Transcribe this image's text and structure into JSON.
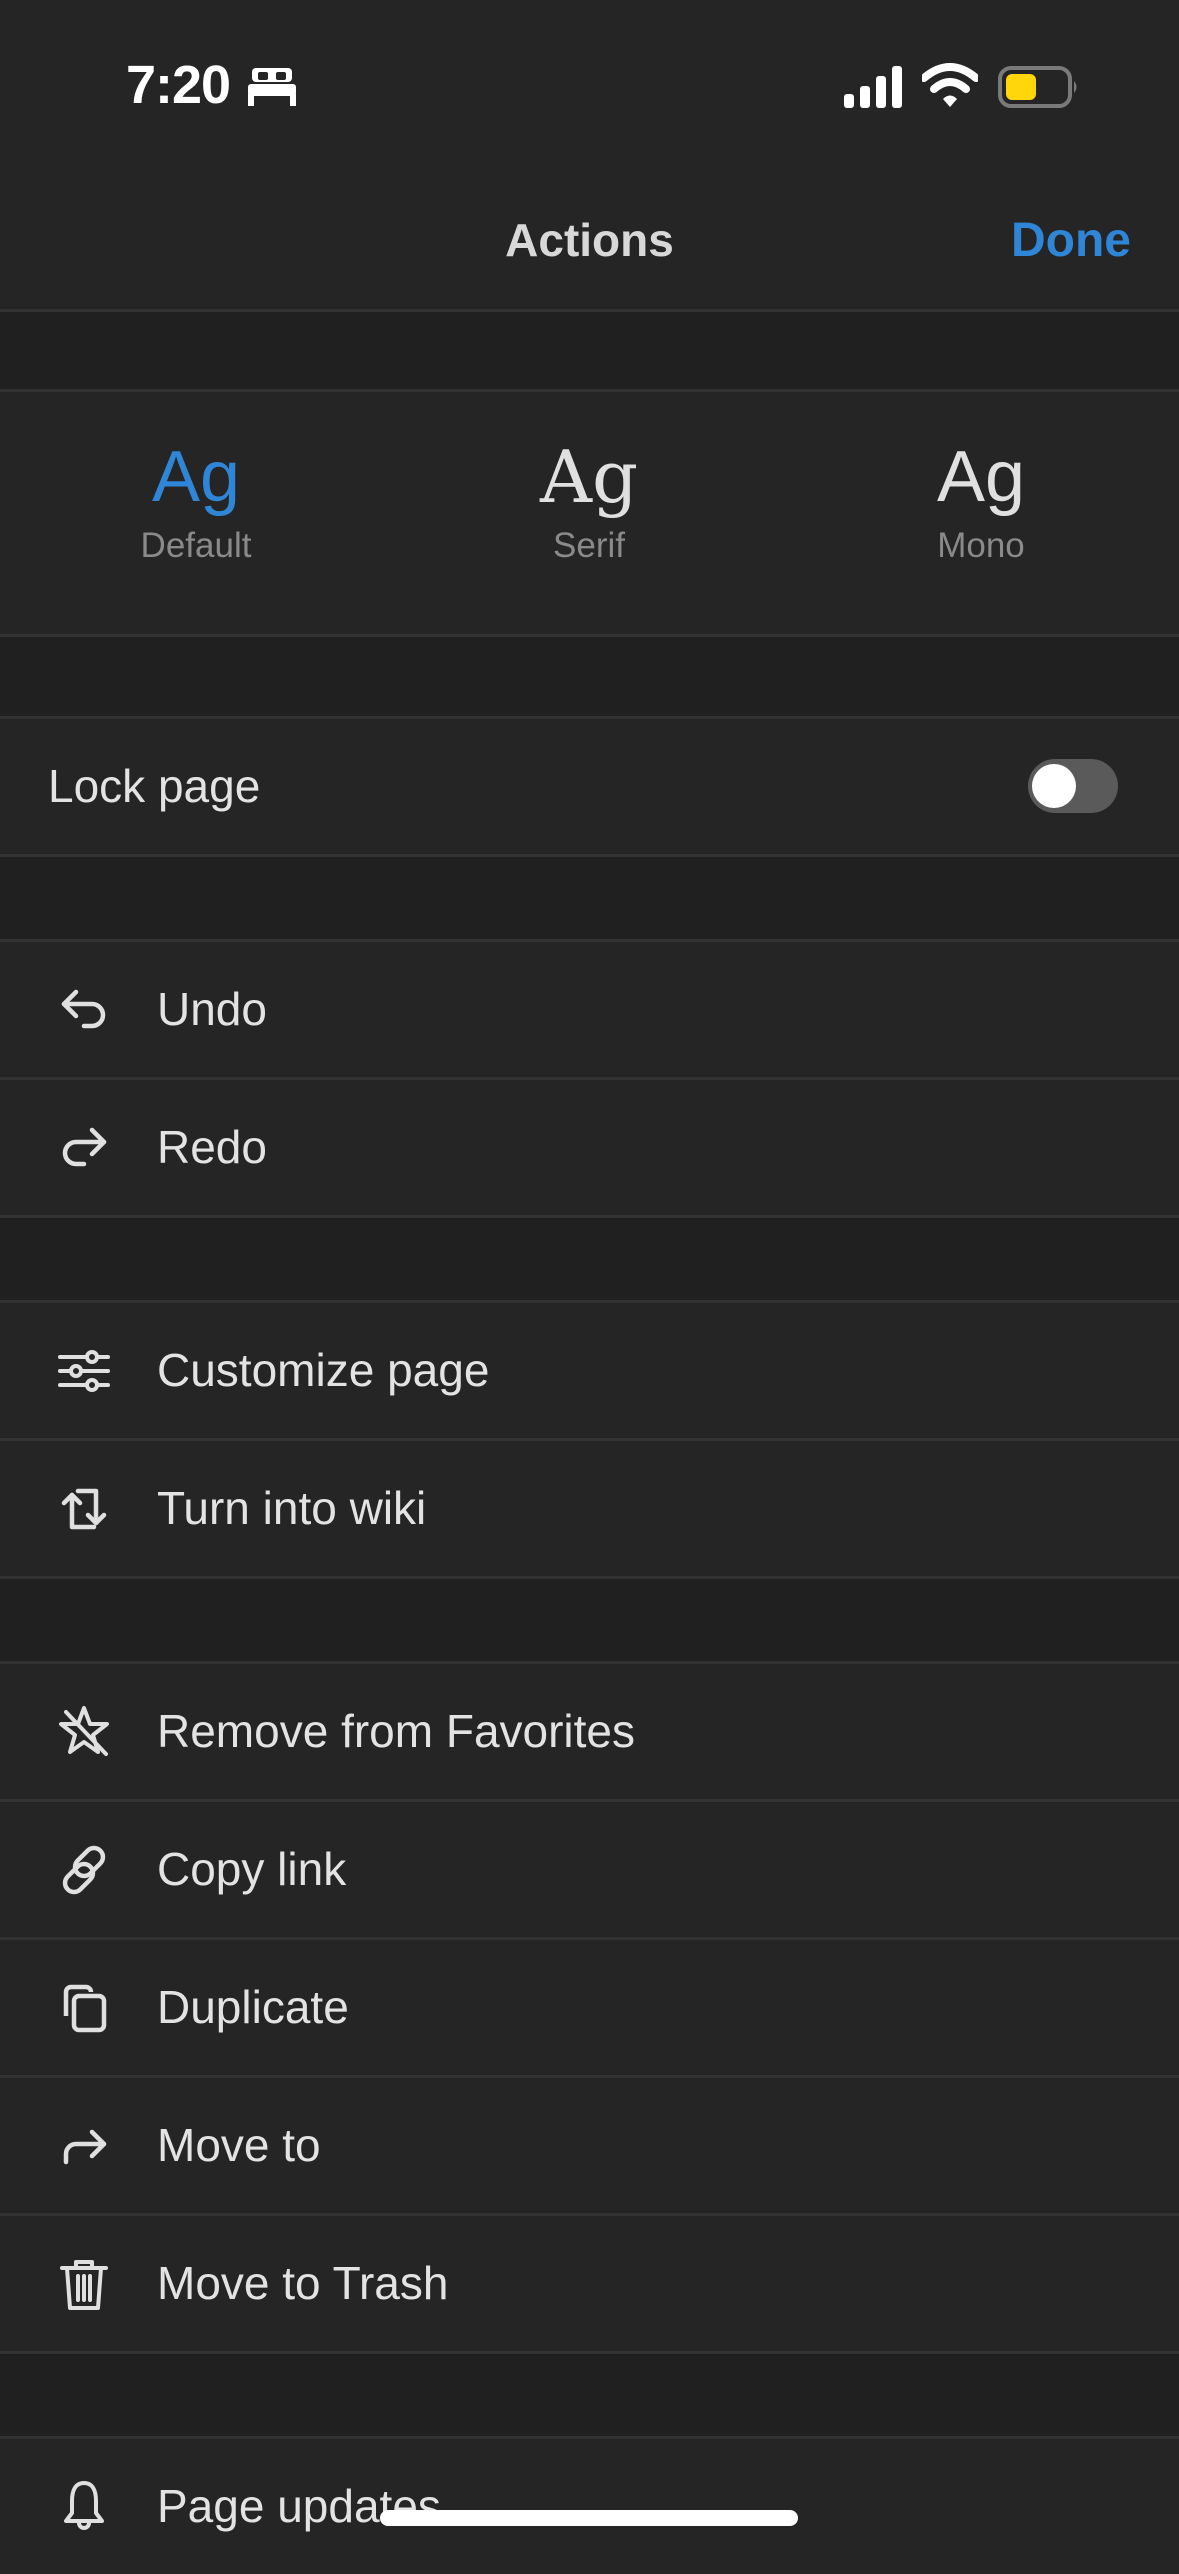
{
  "status_bar": {
    "time": "7:20",
    "focus_icon": "bed-icon",
    "signal_icon": "cellular-signal-icon",
    "wifi_icon": "wifi-icon",
    "battery_icon": "battery-icon",
    "battery_color": "#ffd60a"
  },
  "nav": {
    "title": "Actions",
    "done_label": "Done",
    "accent_color": "#2f86d6"
  },
  "fonts": {
    "selected": "Default",
    "options": [
      {
        "glyph": "Ag",
        "label": "Default"
      },
      {
        "glyph": "Ag",
        "label": "Serif"
      },
      {
        "glyph": "Ag",
        "label": "Mono"
      }
    ]
  },
  "lock": {
    "label": "Lock page",
    "enabled": false
  },
  "groups": [
    {
      "items": [
        {
          "icon": "undo-icon",
          "label": "Undo"
        },
        {
          "icon": "redo-icon",
          "label": "Redo"
        }
      ]
    },
    {
      "items": [
        {
          "icon": "sliders-icon",
          "label": "Customize page"
        },
        {
          "icon": "convert-icon",
          "label": "Turn into wiki"
        }
      ]
    },
    {
      "items": [
        {
          "icon": "star-slash-icon",
          "label": "Remove from Favorites"
        },
        {
          "icon": "link-icon",
          "label": "Copy link"
        },
        {
          "icon": "duplicate-icon",
          "label": "Duplicate"
        },
        {
          "icon": "move-arrow-icon",
          "label": "Move to"
        },
        {
          "icon": "trash-icon",
          "label": "Move to Trash"
        }
      ]
    },
    {
      "items": [
        {
          "icon": "bell-icon",
          "label": "Page updates"
        }
      ]
    }
  ]
}
